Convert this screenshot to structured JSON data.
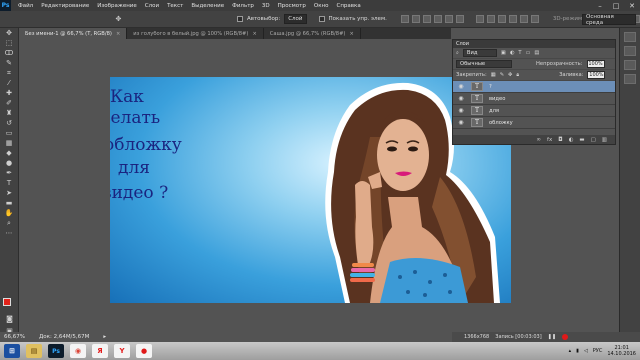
{
  "app": {
    "logo": "Ps",
    "menu": [
      "Файл",
      "Редактирование",
      "Изображение",
      "Слои",
      "Текст",
      "Выделение",
      "Фильтр",
      "3D",
      "Просмотр",
      "Окно",
      "Справка"
    ],
    "window_controls": [
      "–",
      "□",
      "✕"
    ]
  },
  "options": {
    "autoselect_label": "Автовыбор:",
    "autoselect_value": "Слой",
    "show_controls_label": "Показать упр. элем.",
    "mode_3d_label": "3D-режим:",
    "workspace": "Основная среда"
  },
  "tabs": [
    {
      "label": "Без имени-1 @ 66,7% (Т, RGB/8)",
      "active": true
    },
    {
      "label": "из голубого в белый.jpg @ 100% (RGB/8#)",
      "active": false
    },
    {
      "label": "Саша.jpg @ 66,7% (RGB/8#)",
      "active": false
    }
  ],
  "canvas": {
    "words": [
      "Как",
      "делать",
      "обложку",
      "для",
      "видео ?"
    ],
    "text_color": "#1a2480",
    "bg_colors": [
      "#d8f2ff",
      "#3aa0dc",
      "#1770b8"
    ]
  },
  "status": {
    "zoom": "66,67%",
    "doc": "Док: 2,64M/5,67M"
  },
  "layers_panel": {
    "title": "Слои",
    "filter": "Вид",
    "blend_mode": "Обычные",
    "opacity_label": "Непрозрачность:",
    "opacity_value": "100%",
    "lock_label": "Закрепить:",
    "fill_label": "Заливка:",
    "fill_value": "100%",
    "layers": [
      {
        "name": "?",
        "selected": true
      },
      {
        "name": "видео",
        "selected": false
      },
      {
        "name": "для",
        "selected": false
      },
      {
        "name": "обложку",
        "selected": false
      }
    ],
    "footer_icons": [
      "link-icon",
      "fx-icon",
      "mask-icon",
      "adjust-icon",
      "folder-icon",
      "new-layer-icon",
      "trash-icon"
    ]
  },
  "recording": {
    "resolution": "1366x768",
    "label": "Запись [00:03:03]"
  },
  "tray": {
    "lang": "РУС",
    "time": "21:01",
    "date": "14.10.2016"
  },
  "colors": {
    "foreground": "#e2231a",
    "background": "#ffffff",
    "selected_layer": "#6c8fb8"
  }
}
